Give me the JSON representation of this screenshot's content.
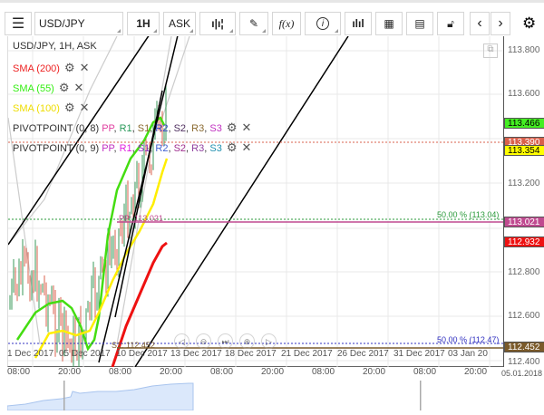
{
  "toolbar": {
    "symbol": "USD/JPY",
    "timeframe": "1H",
    "price_type": "ASK",
    "fx_label": "f(x)"
  },
  "legend": {
    "title": "USD/JPY, 1H, ASK",
    "sma200": "SMA (200)",
    "sma55": "SMA (55)",
    "sma100": "SMA (100)",
    "pivot1": {
      "label": "PIVOTPOINT (0, 8)",
      "items": [
        {
          "t": "PP",
          "c": "#e040a0"
        },
        {
          "t": "R1",
          "c": "#2a9a5a"
        },
        {
          "t": "S1",
          "c": "#8a6a30"
        },
        {
          "t": "R2",
          "c": "#3040c0"
        },
        {
          "t": "S2",
          "c": "#503060"
        },
        {
          "t": "R3",
          "c": "#8a6a30"
        },
        {
          "t": "S3",
          "c": "#c030c0"
        }
      ]
    },
    "pivot2": {
      "label": "PIVOTPOINT (0, 9)",
      "items": [
        {
          "t": "PP",
          "c": "#c030c0"
        },
        {
          "t": "R1",
          "c": "#e020e0"
        },
        {
          "t": "S1",
          "c": "#9030c0"
        },
        {
          "t": "R2",
          "c": "#4060d0"
        },
        {
          "t": "S2",
          "c": "#a03090"
        },
        {
          "t": "R3",
          "c": "#9040a0"
        },
        {
          "t": "S3",
          "c": "#2090b0"
        }
      ]
    }
  },
  "price_axis": {
    "ticks": [
      "113.800",
      "113.600",
      "113.200",
      "112.800",
      "112.600",
      "112.400"
    ],
    "tags": [
      {
        "v": "113.466",
        "bg": "#44ee22",
        "fg": "#000"
      },
      {
        "v": "113.390",
        "bg": "#d9604c",
        "fg": "#fff"
      },
      {
        "v": "113.354",
        "bg": "#ffff00",
        "fg": "#000"
      },
      {
        "v": "113.021",
        "bg": "#c04a90",
        "fg": "#fff"
      },
      {
        "v": "112.932",
        "bg": "#ee1111",
        "fg": "#fff"
      },
      {
        "v": "112.452",
        "bg": "#7a5a2a",
        "fg": "#fff"
      }
    ]
  },
  "annotations": {
    "fib_upper": "50.00 % (113.04)",
    "fib_lower": "50.00 % (112.47)",
    "pp_label": "PP: 113.021",
    "s1_label": "S1: 112.452"
  },
  "date_labels": [
    "1 Dec 2017",
    "05 Dec 2017",
    "10 Dec 2017",
    "13 Dec 2017",
    "18 Dec 2017",
    "21 Dec 2017",
    "26 Dec 2017",
    "31 Dec 2017",
    "03 Jan 20"
  ],
  "hour_labels": [
    "08:00",
    "20:00",
    "08:00",
    "20:00",
    "08:00",
    "20:00",
    "08:00",
    "20:00",
    "08:00",
    "20:00"
  ],
  "end_date": "05.01.2018"
}
